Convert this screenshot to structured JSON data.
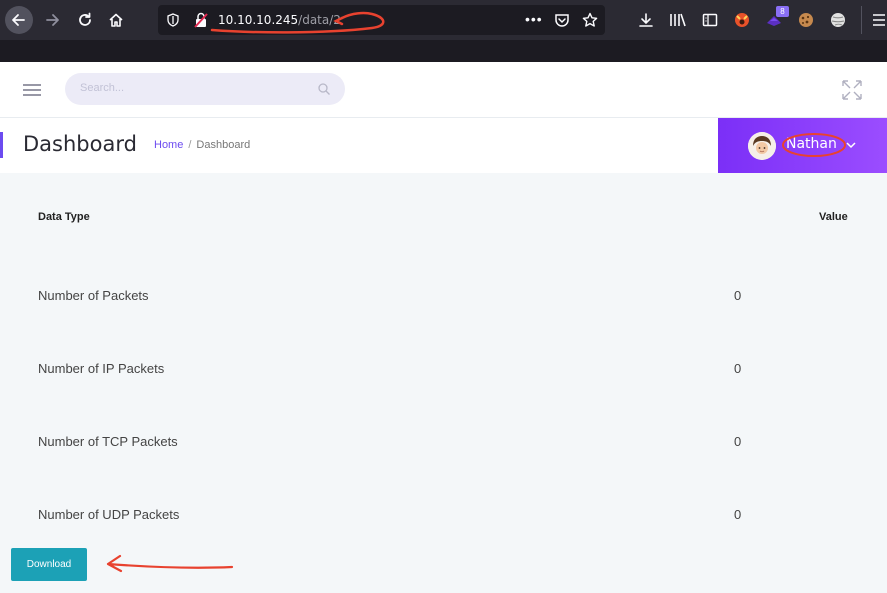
{
  "browser": {
    "url_host": "10.10.10.245",
    "url_path": "/data/2",
    "extension_badge": "8"
  },
  "header": {
    "search_placeholder": "Search..."
  },
  "titlebar": {
    "title": "Dashboard",
    "breadcrumb_home": "Home",
    "breadcrumb_separator": "/",
    "breadcrumb_current": "Dashboard",
    "user_name": "Nathan"
  },
  "table": {
    "headers": {
      "type": "Data Type",
      "value": "Value"
    },
    "rows": [
      {
        "label": "Number of Packets",
        "value": "0"
      },
      {
        "label": "Number of IP Packets",
        "value": "0"
      },
      {
        "label": "Number of TCP Packets",
        "value": "0"
      },
      {
        "label": "Number of UDP Packets",
        "value": "0"
      }
    ]
  },
  "actions": {
    "download_label": "Download"
  },
  "colors": {
    "accent": "#6c4bf0",
    "user_panel": "#8a3ffa",
    "download": "#1ca1b6",
    "annotation": "#e8422f"
  },
  "icons": [
    "back-arrow-icon",
    "forward-arrow-icon",
    "reload-icon",
    "home-icon",
    "shield-icon",
    "insecure-lock-icon",
    "more-dots-icon",
    "pocket-icon",
    "star-icon",
    "download-icon",
    "library-icon",
    "reader-icon",
    "extension-fox-icon",
    "extension-hat-icon",
    "extension-cookie-icon",
    "extension-ball-icon",
    "menu-icon",
    "hamburger-icon",
    "search-icon",
    "expand-icon",
    "chevron-down-icon"
  ]
}
